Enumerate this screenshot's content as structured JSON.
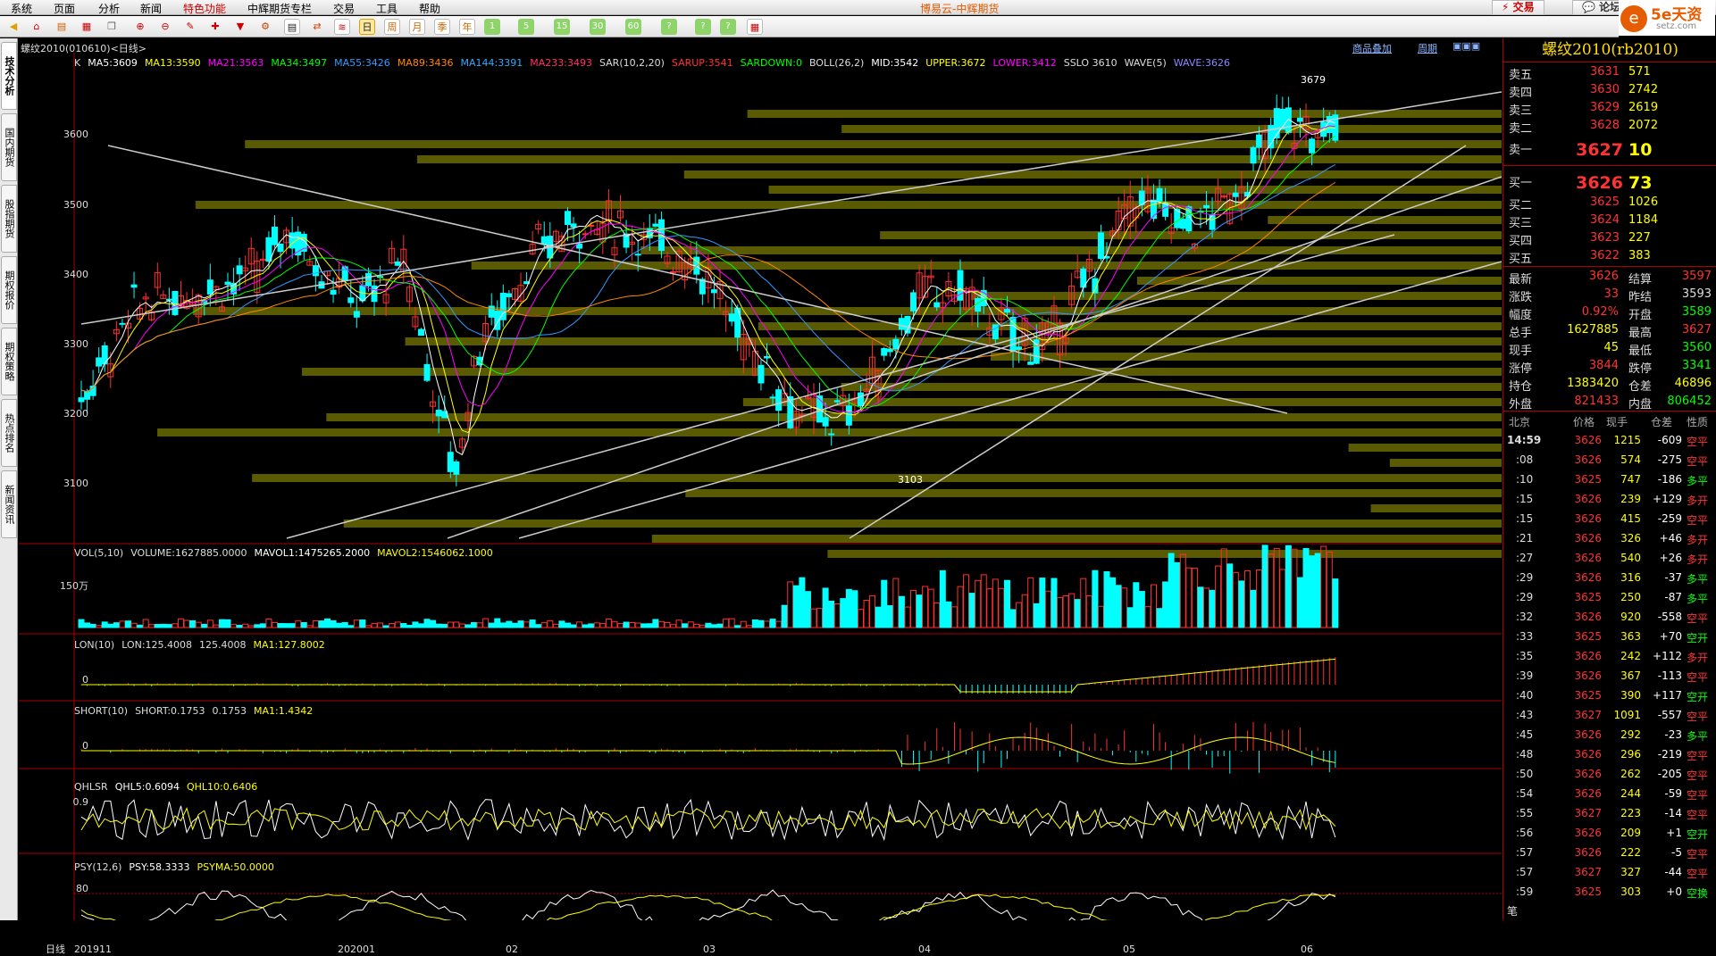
{
  "menu": [
    "系统",
    "页面",
    "分析",
    "新闻",
    "特色功能",
    "中辉期货专栏",
    "交易",
    "工具",
    "帮助"
  ],
  "app_title": "博易云-中辉期货",
  "trade_btn": "交易",
  "forum_btn": "论坛",
  "logo": {
    "main": "5e天资",
    "sub": "setz.com"
  },
  "toolbar_nums": [
    "1",
    "5",
    "15",
    "30",
    "60"
  ],
  "side_tabs": [
    "技术分析",
    "国内期货",
    "股指期货",
    "期权报价",
    "期权策略",
    "热点排名",
    "新闻资讯"
  ],
  "chart_header": {
    "instrument": "螺纹2010(010610)<日线>",
    "link1": "商品叠加",
    "link2": "周期"
  },
  "main_legend": [
    {
      "t": "K",
      "c": "#ddd"
    },
    {
      "t": "MA5:3609",
      "c": "#ffffff"
    },
    {
      "t": "MA13:3590",
      "c": "#ffff00"
    },
    {
      "t": "MA21:3563",
      "c": "#ff00ff"
    },
    {
      "t": "MA34:3497",
      "c": "#00ff00"
    },
    {
      "t": "MA55:3426",
      "c": "#3399ff"
    },
    {
      "t": "MA89:3436",
      "c": "#ff8800"
    },
    {
      "t": "MA144:3391",
      "c": "#33aaff"
    },
    {
      "t": "MA233:3493",
      "c": "#ff3366"
    },
    {
      "t": "SAR(10,2,20)",
      "c": "#ddd"
    },
    {
      "t": "SARUP:3541",
      "c": "#ff3333"
    },
    {
      "t": "SARDOWN:0",
      "c": "#00ff00"
    },
    {
      "t": "BOLL(26,2)",
      "c": "#ddd"
    },
    {
      "t": "MID:3542",
      "c": "#ffffff"
    },
    {
      "t": "UPPER:3672",
      "c": "#ffff00"
    },
    {
      "t": "LOWER:3412",
      "c": "#ff00ff"
    },
    {
      "t": "SSLO 3610",
      "c": "#ddd"
    },
    {
      "t": "WAVE(5)",
      "c": "#ddd"
    },
    {
      "t": "WAVE:3626",
      "c": "#8888ff"
    }
  ],
  "y_ticks": [
    "3600",
    "3500",
    "3400",
    "3300",
    "3200",
    "3100"
  ],
  "annotations": {
    "high": "3679",
    "low": "3103"
  },
  "vol_legend": [
    {
      "t": "VOL(5,10)",
      "c": "#ddd"
    },
    {
      "t": "VOLUME:1627885.0000",
      "c": "#ddd"
    },
    {
      "t": "MAVOL1:1475265.2000",
      "c": "#ffffff"
    },
    {
      "t": "MAVOL2:1546062.1000",
      "c": "#ffff00"
    }
  ],
  "vol_tick": "150万",
  "lon_legend": [
    {
      "t": "LON(10)",
      "c": "#ddd"
    },
    {
      "t": "LON:125.4008",
      "c": "#ddd"
    },
    {
      "t": "125.4008",
      "c": "#ddd"
    },
    {
      "t": "MA1:127.8002",
      "c": "#ffff00"
    }
  ],
  "lon_tick": "0",
  "short_legend": [
    {
      "t": "SHORT(10)",
      "c": "#ddd"
    },
    {
      "t": "SHORT:0.1753",
      "c": "#ddd"
    },
    {
      "t": "0.1753",
      "c": "#ddd"
    },
    {
      "t": "MA1:1.4342",
      "c": "#ffff00"
    }
  ],
  "short_tick": "0",
  "qhlsr_legend": [
    {
      "t": "QHLSR",
      "c": "#ddd"
    },
    {
      "t": "QHL5:0.6094",
      "c": "#ffffff"
    },
    {
      "t": "QHL10:0.6406",
      "c": "#ffff00"
    }
  ],
  "qhlsr_tick": "0.9",
  "psy_legend": [
    {
      "t": "PSY(12,6)",
      "c": "#ddd"
    },
    {
      "t": "PSY:58.3333",
      "c": "#ffffff"
    },
    {
      "t": "PSYMA:50.0000",
      "c": "#ffff00"
    }
  ],
  "psy_tick": "80",
  "date_axis": {
    "label": "日线",
    "ticks": [
      "201911",
      "202001",
      "02",
      "03",
      "04",
      "05",
      "06"
    ]
  },
  "quote": {
    "title": "螺纹2010(rb2010)",
    "asks": [
      {
        "l": "卖五",
        "p": "3631",
        "v": "571"
      },
      {
        "l": "卖四",
        "p": "3630",
        "v": "2742"
      },
      {
        "l": "卖三",
        "p": "3629",
        "v": "2619"
      },
      {
        "l": "卖二",
        "p": "3628",
        "v": "2072"
      },
      {
        "l": "卖一",
        "p": "3627",
        "v": "10"
      }
    ],
    "bids": [
      {
        "l": "买一",
        "p": "3626",
        "v": "73"
      },
      {
        "l": "买二",
        "p": "3625",
        "v": "1026"
      },
      {
        "l": "买三",
        "p": "3624",
        "v": "1184"
      },
      {
        "l": "买四",
        "p": "3623",
        "v": "227"
      },
      {
        "l": "买五",
        "p": "3622",
        "v": "383"
      }
    ],
    "stats": [
      {
        "l1": "最新",
        "v1": "3626",
        "c1": "#ff3333",
        "l2": "结算",
        "v2": "3597",
        "c2": "#ff3333"
      },
      {
        "l1": "涨跌",
        "v1": "33",
        "c1": "#ff3333",
        "l2": "昨结",
        "v2": "3593",
        "c2": "#dddddd"
      },
      {
        "l1": "幅度",
        "v1": "0.92%",
        "c1": "#ff3333",
        "l2": "开盘",
        "v2": "3589",
        "c2": "#00ff00"
      },
      {
        "l1": "总手",
        "v1": "1627885",
        "c1": "#ffff00",
        "l2": "最高",
        "v2": "3627",
        "c2": "#ff3333"
      },
      {
        "l1": "现手",
        "v1": "45",
        "c1": "#ffff00",
        "l2": "最低",
        "v2": "3560",
        "c2": "#00ff00"
      },
      {
        "l1": "涨停",
        "v1": "3844",
        "c1": "#ff3333",
        "l2": "跌停",
        "v2": "3341",
        "c2": "#00ff00"
      },
      {
        "l1": "持仓",
        "v1": "1383420",
        "c1": "#ffff00",
        "l2": "仓差",
        "v2": "46896",
        "c2": "#ffff00"
      },
      {
        "l1": "外盘",
        "v1": "821433",
        "c1": "#ff3333",
        "l2": "内盘",
        "v2": "806452",
        "c2": "#00ff00"
      }
    ],
    "tick_header": {
      "c1": "北京",
      "c2": "价格",
      "c3": "现手",
      "c4": "仓差",
      "c5": "性质"
    },
    "ticks": [
      {
        "t": "14:59",
        "p": "3626",
        "v": "1215",
        "d": "-609",
        "n": "空平"
      },
      {
        "t": ":08",
        "p": "3626",
        "v": "574",
        "d": "-275",
        "n": "空平"
      },
      {
        "t": ":10",
        "p": "3625",
        "v": "747",
        "d": "-186",
        "n": "多平"
      },
      {
        "t": ":15",
        "p": "3626",
        "v": "239",
        "d": "+129",
        "n": "多开"
      },
      {
        "t": ":15",
        "p": "3626",
        "v": "415",
        "d": "-259",
        "n": "空平"
      },
      {
        "t": ":21",
        "p": "3626",
        "v": "326",
        "d": "+46",
        "n": "多开"
      },
      {
        "t": ":27",
        "p": "3626",
        "v": "540",
        "d": "+26",
        "n": "多开"
      },
      {
        "t": ":29",
        "p": "3626",
        "v": "316",
        "d": "-37",
        "n": "多平"
      },
      {
        "t": ":29",
        "p": "3625",
        "v": "250",
        "d": "-87",
        "n": "多平"
      },
      {
        "t": ":32",
        "p": "3626",
        "v": "920",
        "d": "-558",
        "n": "空平"
      },
      {
        "t": ":33",
        "p": "3625",
        "v": "363",
        "d": "+70",
        "n": "空开"
      },
      {
        "t": ":35",
        "p": "3626",
        "v": "242",
        "d": "+112",
        "n": "多开"
      },
      {
        "t": ":39",
        "p": "3626",
        "v": "367",
        "d": "-113",
        "n": "空平"
      },
      {
        "t": ":40",
        "p": "3625",
        "v": "390",
        "d": "+117",
        "n": "空开"
      },
      {
        "t": ":43",
        "p": "3627",
        "v": "1091",
        "d": "-557",
        "n": "空平"
      },
      {
        "t": ":45",
        "p": "3626",
        "v": "292",
        "d": "-23",
        "n": "多平"
      },
      {
        "t": ":48",
        "p": "3626",
        "v": "296",
        "d": "-219",
        "n": "空平"
      },
      {
        "t": ":50",
        "p": "3626",
        "v": "262",
        "d": "-205",
        "n": "空平"
      },
      {
        "t": ":54",
        "p": "3626",
        "v": "244",
        "d": "-59",
        "n": "空平"
      },
      {
        "t": ":55",
        "p": "3627",
        "v": "223",
        "d": "-14",
        "n": "空平"
      },
      {
        "t": ":56",
        "p": "3626",
        "v": "209",
        "d": "+1",
        "n": "空开"
      },
      {
        "t": ":57",
        "p": "3626",
        "v": "222",
        "d": "-5",
        "n": "空平"
      },
      {
        "t": ":57",
        "p": "3627",
        "v": "327",
        "d": "-44",
        "n": "空平"
      },
      {
        "t": ":59",
        "p": "3625",
        "v": "303",
        "d": "+0",
        "n": "空换"
      }
    ],
    "bottom_tab": "笔"
  }
}
